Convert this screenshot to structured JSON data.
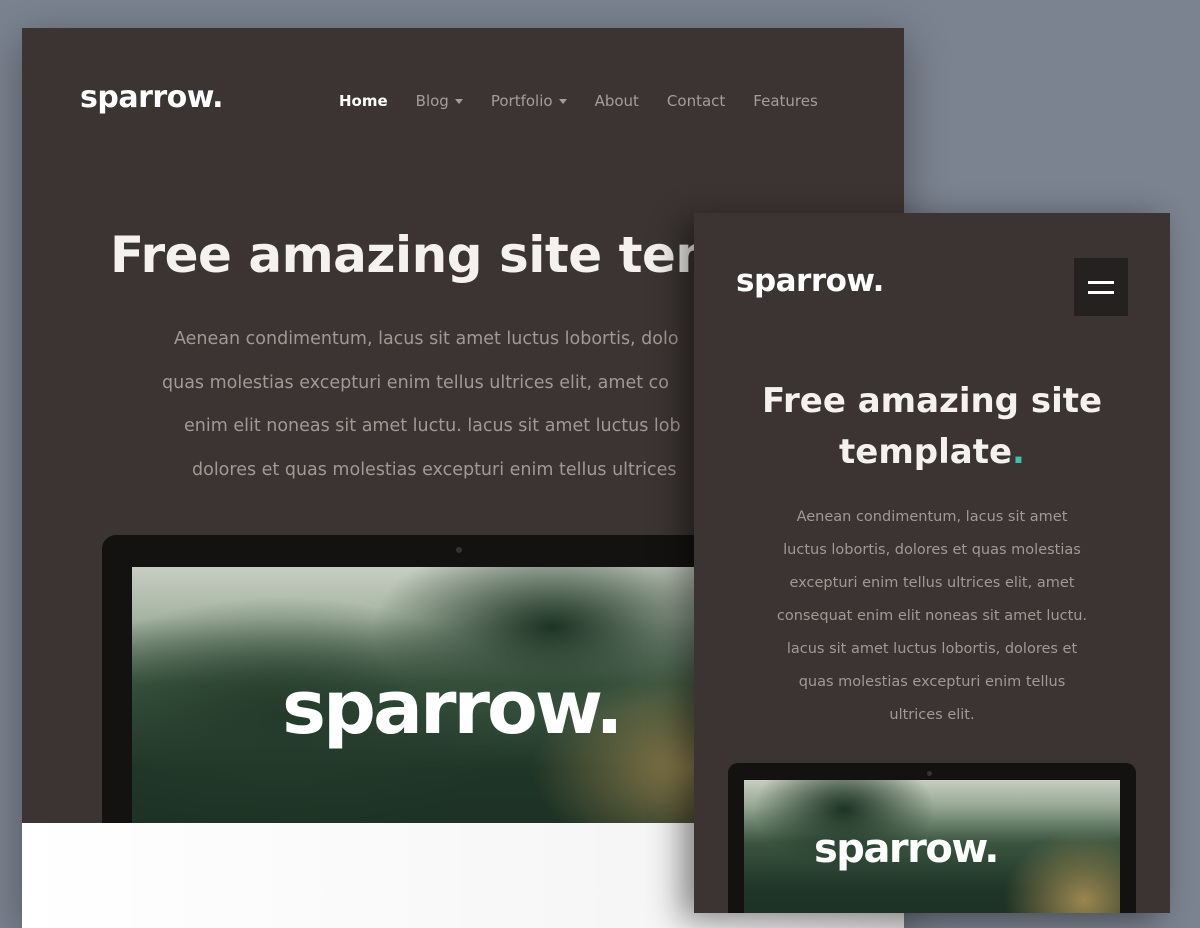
{
  "desktop": {
    "logo": "sparrow.",
    "nav": [
      {
        "label": "Home",
        "active": true,
        "dropdown": false
      },
      {
        "label": "Blog",
        "active": false,
        "dropdown": true
      },
      {
        "label": "Portfolio",
        "active": false,
        "dropdown": true
      },
      {
        "label": "About",
        "active": false,
        "dropdown": false
      },
      {
        "label": "Contact",
        "active": false,
        "dropdown": false
      },
      {
        "label": "Features",
        "active": false,
        "dropdown": false
      }
    ],
    "hero_title": "Free amazing site temp",
    "hero_paragraph_lines": [
      "Aenean condimentum, lacus sit amet luctus lobortis, dolo",
      "quas molestias excepturi enim tellus ultrices elit, amet co",
      "enim elit noneas sit amet luctu. lacus sit amet luctus lob",
      "dolores et quas molestias excepturi enim tellus ultrices"
    ],
    "screen_logo": "sparrow."
  },
  "mobile": {
    "logo": "sparrow.",
    "menu_icon": "hamburger-menu-icon",
    "hero_title_line1": "Free amazing site",
    "hero_title_line2": "template",
    "hero_title_dot": ".",
    "hero_paragraph_lines": [
      "Aenean condimentum, lacus sit amet",
      "luctus lobortis, dolores et quas molestias",
      "excepturi enim tellus ultrices elit, amet",
      "consequat enim elit noneas sit amet luctu.",
      "lacus sit amet luctus lobortis, dolores et",
      "quas molestias excepturi enim tellus",
      "ultrices elit."
    ],
    "screen_logo": "sparrow."
  },
  "colors": {
    "background": "#7b8390",
    "page_dark": "#3b3433",
    "accent": "#3fc0a8",
    "nav_inactive": "#a59d9b"
  }
}
